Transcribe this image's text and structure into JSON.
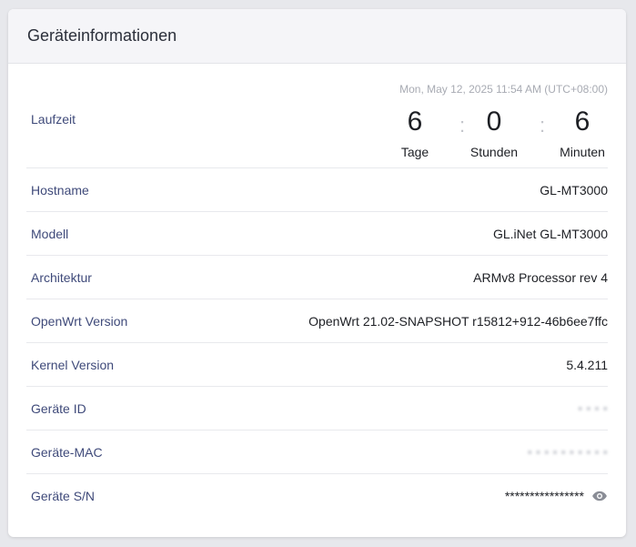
{
  "card": {
    "title": "Geräteinformationen"
  },
  "uptime": {
    "label": "Laufzeit",
    "timestamp": "Mon, May 12, 2025 11:54 AM (UTC+08:00)",
    "days": "6",
    "days_label": "Tage",
    "hours": "0",
    "hours_label": "Stunden",
    "minutes": "6",
    "minutes_label": "Minuten",
    "separator": ":"
  },
  "rows": {
    "hostname": {
      "label": "Hostname",
      "value": "GL-MT3000"
    },
    "model": {
      "label": "Modell",
      "value": "GL.iNet GL-MT3000"
    },
    "architecture": {
      "label": "Architektur",
      "value": "ARMv8 Processor rev 4"
    },
    "openwrt": {
      "label": "OpenWrt Version",
      "value": "OpenWrt 21.02-SNAPSHOT r15812+912-46b6ee7ffc"
    },
    "kernel": {
      "label": "Kernel Version",
      "value": "5.4.211"
    },
    "device_id": {
      "label": "Geräte ID",
      "value": ""
    },
    "mac": {
      "label": "Geräte-MAC",
      "value": ""
    },
    "serial": {
      "label": "Geräte S/N",
      "value": "****************",
      "toggle_icon": "eye-icon"
    }
  },
  "colors": {
    "label": "#3f4a7a",
    "value": "#1d1f24",
    "header_bg": "#f5f5f8",
    "timestamp": "#a8abb3"
  }
}
